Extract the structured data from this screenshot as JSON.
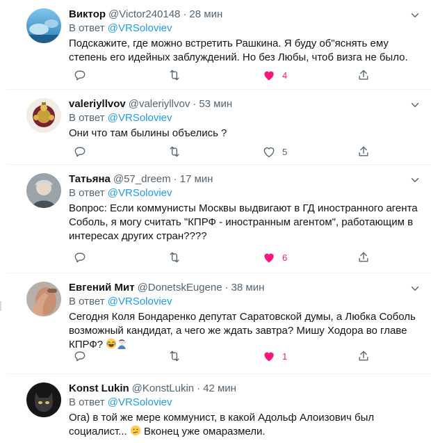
{
  "tweets": [
    {
      "name": "Виктор",
      "handle": "@Victor240148",
      "time": "28 мин",
      "reply_prefix": "В ответ",
      "reply_to": "@VRSoloviev",
      "text": "Подскажите, где можно встретить Рашкина. Я буду об\"яснять ему\nстепень его идейных заблуждений. Но без Любы, чтоб визга не было.",
      "likes": "4",
      "liked": true
    },
    {
      "name": "valeriyllvov",
      "handle": "@valeriyllvov",
      "time": "53 мин",
      "reply_prefix": "В ответ",
      "reply_to": "@VRSoloviev",
      "text": "Они что там былины объелись ?",
      "likes": "5",
      "liked": false
    },
    {
      "name": "Татьяна",
      "handle": "@57_dreem",
      "time": "17 мин",
      "reply_prefix": "В ответ",
      "reply_to": "@VRSoloviev",
      "text": "Вопрос: Если коммунисты Москвы выдвигают в ГД иностранного агента\nСоболь, я могу считать \"КПРФ - иностранным агентом\", работающим в\nинтересах других стран????",
      "likes": "6",
      "liked": true
    },
    {
      "name": "Евгений Мит",
      "handle": "@DonetskEugene",
      "time": "38 мин",
      "reply_prefix": "В ответ",
      "reply_to": "@VRSoloviev",
      "text": "Сегодня Коля Бондаренко депутат Саратовской думы, а Любка Соболь\nвозможный кандидат, а чего же ждать завтра? Мишу Ходора во главе\nКПРФ?",
      "likes": "1",
      "liked": true
    },
    {
      "name": "Konst Lukin",
      "handle": "@KonstLukin",
      "time": "42 мин",
      "reply_prefix": "В ответ",
      "reply_to": "@VRSoloviev",
      "text_a": "Ога) в той же мере коммунист, в какой Адольф Алоизович был\nсоциалист...",
      "text_b": "Вконец уже омаразмели."
    }
  ],
  "icons": {
    "reply": "reply-icon",
    "retweet": "retweet-icon",
    "like": "heart-icon",
    "share": "share-icon",
    "more": "chevron-down-icon"
  },
  "colors": {
    "accent": "#1d9bf0",
    "like": "#f91880",
    "muted": "#536471"
  }
}
